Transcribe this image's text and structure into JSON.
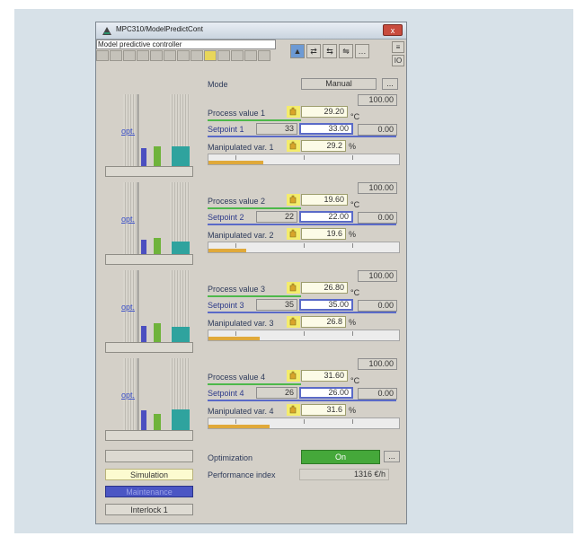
{
  "window": {
    "title": "MPC310/ModelPredictCont",
    "close_label": "x"
  },
  "header": {
    "controller_name": "Model predictive controller"
  },
  "toolbar": {
    "buttons": [
      "▲",
      "⇄",
      "⇆",
      "⇋",
      "…"
    ],
    "side": [
      "≡",
      "IO"
    ]
  },
  "mode": {
    "label": "Mode",
    "value": "Manual",
    "more": "..."
  },
  "loops": [
    {
      "pv_label": "Process value 1",
      "pv": "29.20",
      "pv_unit": "°C",
      "pv_hi": "100.00",
      "sp_label": "Setpoint 1",
      "sp_ext": "33",
      "sp": "33.00",
      "sp_lo": "0.00",
      "mv_label": "Manipulated var. 1",
      "mv": "29.2",
      "mv_unit": "%",
      "mv_fill": 0.29,
      "opt": "opt."
    },
    {
      "pv_label": "Process value 2",
      "pv": "19.60",
      "pv_unit": "°C",
      "pv_hi": "100.00",
      "sp_label": "Setpoint 2",
      "sp_ext": "22",
      "sp": "22.00",
      "sp_lo": "0.00",
      "mv_label": "Manipulated var. 2",
      "mv": "19.6",
      "mv_unit": "%",
      "mv_fill": 0.2,
      "opt": "opt."
    },
    {
      "pv_label": "Process value 3",
      "pv": "26.80",
      "pv_unit": "°C",
      "pv_hi": "100.00",
      "sp_label": "Setpoint 3",
      "sp_ext": "35",
      "sp": "35.00",
      "sp_lo": "0.00",
      "mv_label": "Manipulated var. 3",
      "mv": "26.8",
      "mv_unit": "%",
      "mv_fill": 0.27,
      "opt": "opt."
    },
    {
      "pv_label": "Process value 4",
      "pv": "31.60",
      "pv_unit": "°C",
      "pv_hi": "100.00",
      "sp_label": "Setpoint 4",
      "sp_ext": "26",
      "sp": "26.00",
      "sp_lo": "0.00",
      "mv_label": "Manipulated var. 4",
      "mv": "31.6",
      "mv_unit": "%",
      "mv_fill": 0.32,
      "opt": "opt."
    }
  ],
  "optimization": {
    "label": "Optimization",
    "state": "On",
    "more": "..."
  },
  "performance": {
    "label": "Performance index",
    "value": "1316 €/h"
  },
  "status_buttons": {
    "simulation": "Simulation",
    "maintenance": "Maintenance",
    "interlock": "Interlock 1"
  },
  "colors": {
    "pv_bar": "#4b4fc0",
    "sp_bar": "#6fb33b",
    "mv_bar": "#2fa39e",
    "gauge_fill": "#e0a93a",
    "on_green": "#45a83a"
  }
}
